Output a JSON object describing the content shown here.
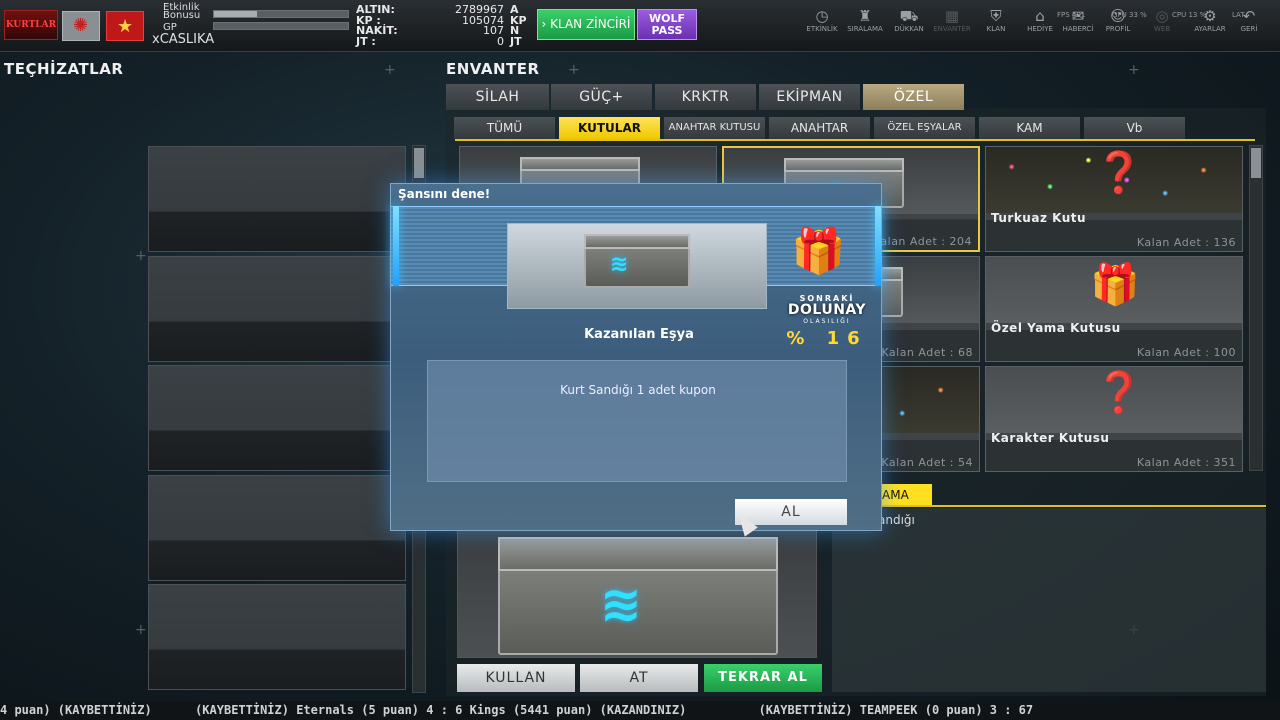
{
  "topbar": {
    "logo_text": "KURTLAR",
    "bonus_label_1": "Etkinlik",
    "bonus_label_2": "Bonusu",
    "bonus_progress": 0.32,
    "gp_label": "GP",
    "gp_progress": 0.0,
    "player_name": "xCASLIKA",
    "currencies": [
      {
        "key": "ALTIN:",
        "value": "2789967",
        "unit": "A"
      },
      {
        "key": "KP :",
        "value": "105074",
        "unit": "KP"
      },
      {
        "key": "NAKİT:",
        "value": "107",
        "unit": "N"
      },
      {
        "key": "JT :",
        "value": "0",
        "unit": "JT"
      }
    ],
    "klan_button": "› KLAN ZİNCİRİ",
    "wolf_button_1": "WOLF",
    "wolf_button_2": "PASS",
    "menu": [
      {
        "label": "ETKİNLİK",
        "icon": "clock-icon",
        "glyph": "◷"
      },
      {
        "label": "SIRALAMA",
        "icon": "ranking-icon",
        "glyph": "♜"
      },
      {
        "label": "DÜKKAN",
        "icon": "cart-icon",
        "glyph": "⛟"
      },
      {
        "label": "ENVANTER",
        "icon": "inventory-icon",
        "glyph": "▦"
      },
      {
        "label": "KLAN",
        "icon": "shield-icon",
        "glyph": "⛨"
      },
      {
        "label": "HEDİYE",
        "icon": "gift-icon",
        "glyph": "⌂"
      },
      {
        "label": "HABERCİ",
        "icon": "messenger-icon",
        "glyph": "✉"
      },
      {
        "label": "PROFİL",
        "icon": "profile-icon",
        "glyph": "☺"
      },
      {
        "label": "WEB",
        "icon": "web-icon",
        "glyph": "◎"
      },
      {
        "label": "AYARLAR",
        "icon": "settings-icon",
        "glyph": "⚙"
      },
      {
        "label": "GERİ",
        "icon": "back-icon",
        "glyph": "↶"
      }
    ],
    "fps": "FPS 401",
    "gpu": "GPU 33 %",
    "cpu": "CPU 13 %",
    "lat": "LAT"
  },
  "left": {
    "title": "TEÇHİZATLAR"
  },
  "inventory": {
    "title": "ENVANTER",
    "tabs": [
      "SİLAH",
      "GÜÇ+",
      "KRKTR",
      "EKİPMAN",
      "ÖZEL"
    ],
    "active_tab": "ÖZEL",
    "subtabs": [
      "TÜMÜ",
      "KUTULAR",
      "ANAHTAR KUTUSU",
      "ANAHTAR",
      "ÖZEL EŞYALAR",
      "KAM",
      "Vb"
    ],
    "active_subtab": "KUTULAR",
    "items": [
      {
        "name": "",
        "qty": ""
      },
      {
        "name": "",
        "qty": "Kalan Adet : 204"
      },
      {
        "name": "Turkuaz Kutu",
        "qty": "Kalan Adet : 136"
      },
      {
        "name": "",
        "qty": ""
      },
      {
        "name": "",
        "qty": "Kalan Adet : 68"
      },
      {
        "name": "Özel Yama Kutusu",
        "qty": "Kalan Adet : 100"
      },
      {
        "name": "",
        "qty": ""
      },
      {
        "name": "",
        "qty": "Kalan Adet : 54"
      },
      {
        "name": "Karakter Kutusu",
        "qty": "Kalan Adet : 351"
      }
    ],
    "desc_tab": "AMA",
    "desc_text": "andığı",
    "actions": {
      "use": "KULLAN",
      "drop": "AT",
      "rebuy": "TEKRAR AL"
    }
  },
  "modal": {
    "title": "Şansını dene!",
    "won_label": "Kazanılan Eşya",
    "won_text": "Kurt Sandığı 1 adet kupon",
    "next_1": "SONRAKİ",
    "next_2": "DOLUNAY",
    "next_3": "OLASILIĞI",
    "next_pct": "% 16",
    "take_button": "AL"
  },
  "ticker": {
    "text": "4 puan) (KAYBETTİNİZ)      (KAYBETTİNİZ) Eternals (5 puan) 4 : 6 Kings (5441 puan) (KAZANDINIZ)          (KAYBETTİNİZ) TEAMPEEK (0 puan) 3 : 67"
  },
  "colors": {
    "accent": "#f0c800",
    "green": "#1a9a44",
    "purple": "#6b30b0",
    "modal_blue": "#3c5d7c"
  }
}
